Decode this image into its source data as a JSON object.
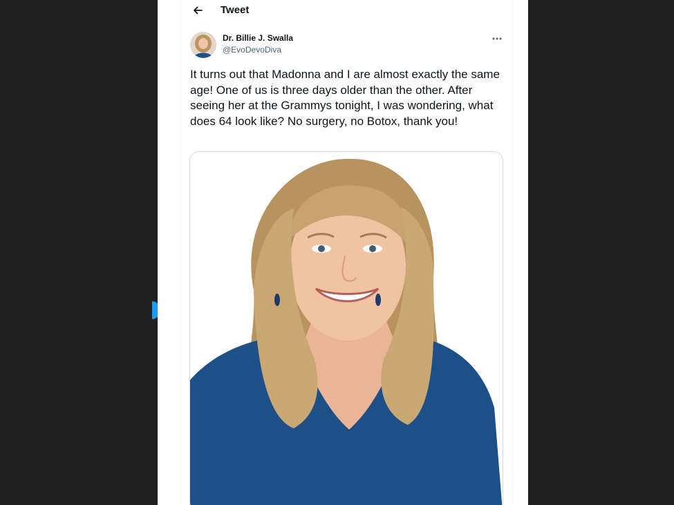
{
  "header": {
    "title": "Tweet",
    "back_icon": "arrow-left-icon"
  },
  "tweet": {
    "author": {
      "display_name": "Dr. Billie J. Swalla",
      "handle": "@EvoDevoDiva"
    },
    "more_icon": "more-horizontal-icon",
    "text": "It turns out that Madonna and I are almost exactly the same age! One of us is three days older than the other. After seeing her at the Grammys tonight, I was wondering, what does 64 look like? No surgery, no Botox, thank you!"
  },
  "colors": {
    "page_background": "#202020",
    "card_background": "#ffffff",
    "text_primary": "#0f1419",
    "text_secondary": "#536471",
    "accent": "#1d9bf0",
    "shirt_blue": "#1d4f88",
    "hair_blonde": "#c9a874"
  }
}
